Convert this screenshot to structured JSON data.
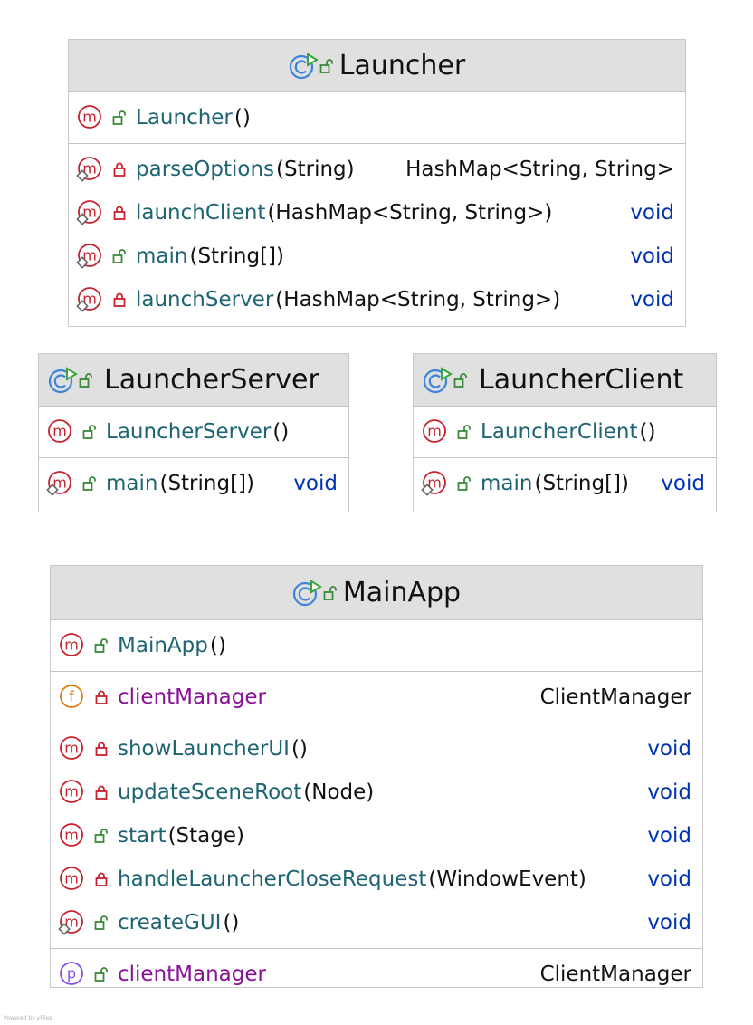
{
  "colors": {
    "method": "#c7222d",
    "field": "#e07b14",
    "property": "#8a4de8",
    "class_icon": "#3d82dc",
    "class_run": "#3aa53a",
    "public": "#3a8a3a",
    "private": "#c7222d",
    "name": "#1e6472",
    "field_name": "#871094",
    "void": "#0033b3"
  },
  "classes": [
    {
      "id": "launcher",
      "title": "Launcher",
      "sections": [
        [
          {
            "kind": "method",
            "vis": "public",
            "name": "Launcher",
            "params": "()",
            "type": ""
          }
        ],
        [
          {
            "kind": "method-static",
            "vis": "private",
            "name": "parseOptions",
            "params": "(String)",
            "type": "HashMap<String, String>"
          },
          {
            "kind": "method-static",
            "vis": "private",
            "name": "launchClient",
            "params": "(HashMap<String, String>)",
            "type": "void"
          },
          {
            "kind": "method-static",
            "vis": "public",
            "name": "main",
            "params": "(String[])",
            "type": "void"
          },
          {
            "kind": "method-static",
            "vis": "private",
            "name": "launchServer",
            "params": "(HashMap<String, String>)",
            "type": "void"
          }
        ]
      ]
    },
    {
      "id": "launcher-server",
      "title": "LauncherServer",
      "sections": [
        [
          {
            "kind": "method",
            "vis": "public",
            "name": "LauncherServer",
            "params": "()",
            "type": ""
          }
        ],
        [
          {
            "kind": "method-static",
            "vis": "public",
            "name": "main",
            "params": "(String[])",
            "type": "void"
          }
        ]
      ]
    },
    {
      "id": "launcher-client",
      "title": "LauncherClient",
      "sections": [
        [
          {
            "kind": "method",
            "vis": "public",
            "name": "LauncherClient",
            "params": "()",
            "type": ""
          }
        ],
        [
          {
            "kind": "method-static",
            "vis": "public",
            "name": "main",
            "params": "(String[])",
            "type": "void"
          }
        ]
      ]
    },
    {
      "id": "main-app",
      "title": "MainApp",
      "sections": [
        [
          {
            "kind": "method",
            "vis": "public",
            "name": "MainApp",
            "params": "()",
            "type": ""
          }
        ],
        [
          {
            "kind": "field",
            "vis": "private",
            "name": "clientManager",
            "params": "",
            "type": "ClientManager"
          }
        ],
        [
          {
            "kind": "method",
            "vis": "private",
            "name": "showLauncherUI",
            "params": "()",
            "type": "void"
          },
          {
            "kind": "method",
            "vis": "private",
            "name": "updateSceneRoot",
            "params": "(Node)",
            "type": "void"
          },
          {
            "kind": "method",
            "vis": "public",
            "name": "start",
            "params": "(Stage)",
            "type": "void"
          },
          {
            "kind": "method",
            "vis": "private",
            "name": "handleLauncherCloseRequest",
            "params": "(WindowEvent)",
            "type": "void"
          },
          {
            "kind": "method-static",
            "vis": "public",
            "name": "createGUI",
            "params": "()",
            "type": "void"
          }
        ],
        [
          {
            "kind": "property",
            "vis": "public",
            "name": "clientManager",
            "params": "",
            "type": "ClientManager"
          }
        ]
      ]
    }
  ],
  "credit": "Powered by yFiles"
}
